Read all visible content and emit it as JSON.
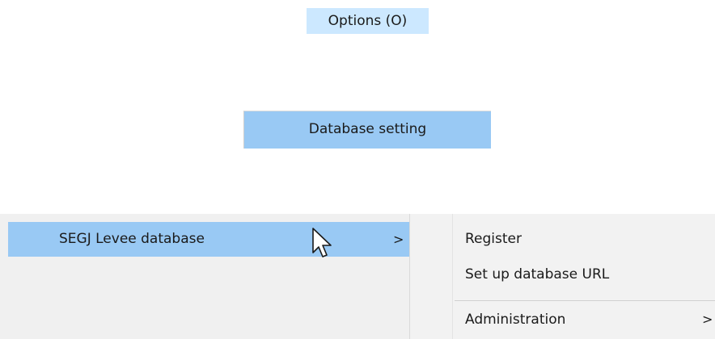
{
  "menu": {
    "title": "Options (O)"
  },
  "options_menu": {
    "database_setting": "Database setting"
  },
  "database_submenu": {
    "levee_label": "SEGJ Levee database",
    "levee_arrow": ">"
  },
  "levee_submenu": {
    "items": [
      {
        "label": "Register"
      },
      {
        "label": "Set up database URL"
      },
      {
        "label": "Administration",
        "arrow": ">"
      }
    ]
  },
  "colors": {
    "highlight": "#99c9f4",
    "menubar_highlight": "#cce8ff",
    "menu_background": "#f0f0f0"
  },
  "icons": {
    "cursor": "arrow-cursor-icon",
    "submenu_arrow": "chevron-right-icon"
  }
}
